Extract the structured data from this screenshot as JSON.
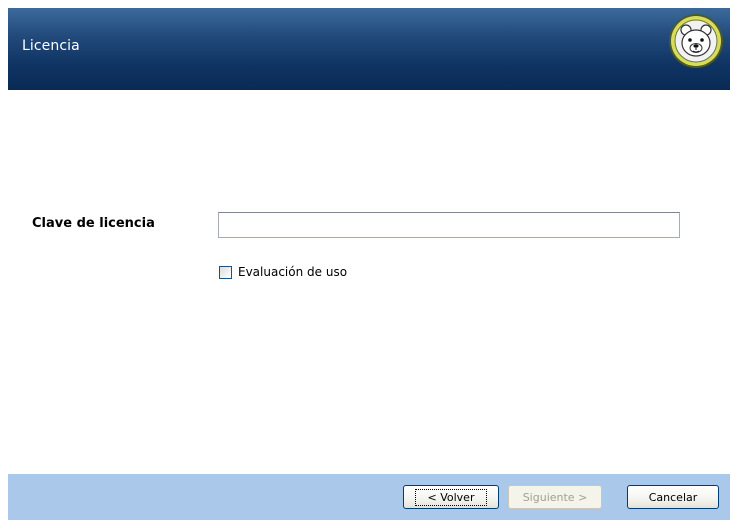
{
  "header": {
    "title": "Licencia",
    "logo_icon": "polar-bear-icon"
  },
  "form": {
    "license_label": "Clave de licencia",
    "license_value": "",
    "license_placeholder": "",
    "evaluation_label": "Evaluación de uso",
    "evaluation_checked": false
  },
  "footer": {
    "back_label": "< Volver",
    "next_label": "Siguiente >",
    "cancel_label": "Cancelar"
  },
  "colors": {
    "header_dark": "#0a2a55",
    "header_light": "#3c6a9c",
    "footer_bg": "#a9c8ea",
    "button_border": "#003c74"
  }
}
